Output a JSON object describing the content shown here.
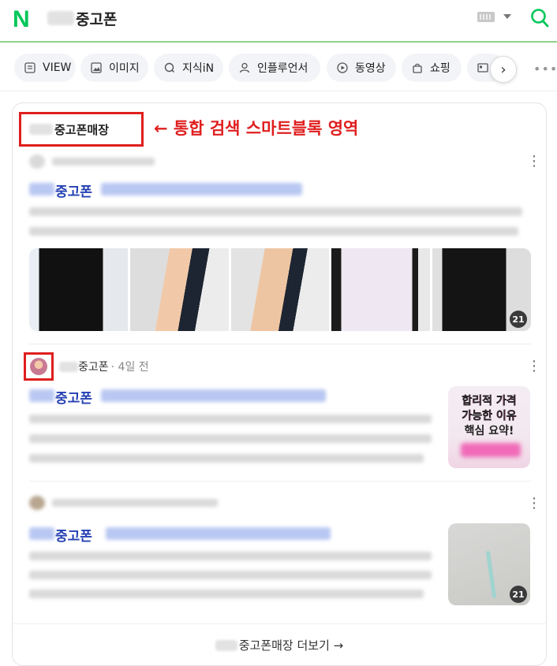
{
  "header": {
    "logo": "N",
    "query": "중고폰"
  },
  "tabs": [
    {
      "label": "VIEW",
      "icon": "view-icon"
    },
    {
      "label": "이미지",
      "icon": "image-icon"
    },
    {
      "label": "지식iN",
      "icon": "q-icon"
    },
    {
      "label": "인플루언서",
      "icon": "person-icon"
    },
    {
      "label": "동영상",
      "icon": "play-icon"
    },
    {
      "label": "쇼핑",
      "icon": "bag-icon"
    }
  ],
  "tabs_next": "›",
  "tabs_more": "•••",
  "block": {
    "title": "중고폰매장",
    "annotation": "← 통합 검색 스마트블록 영역",
    "more_label": "중고폰매장 더보기 →"
  },
  "posts": [
    {
      "link_keyword": "중고폰",
      "gallery_count": "21"
    },
    {
      "author_name": "중고폰",
      "time_ago": "· 4일 전",
      "link_keyword": "중고폰",
      "thumb_line1": "합리적 가격",
      "thumb_line2": "가능한 이유",
      "thumb_line3": "핵심 요약!"
    },
    {
      "link_keyword": "중고폰",
      "thumb_count": "21"
    }
  ],
  "colors": {
    "brand_green": "#03c75a",
    "annotation_red": "#e01e1e",
    "link_blue": "#2440b3"
  }
}
